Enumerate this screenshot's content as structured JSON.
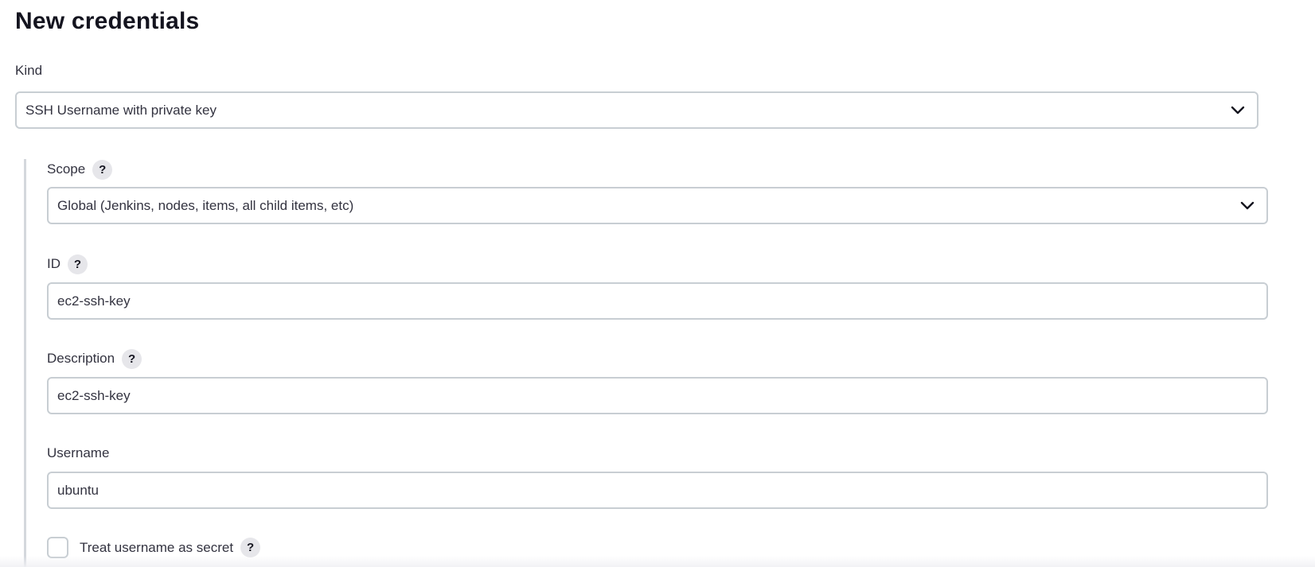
{
  "page": {
    "title": "New credentials"
  },
  "kind": {
    "label": "Kind",
    "selected": "SSH Username with private key"
  },
  "scope": {
    "label": "Scope",
    "help": "?",
    "selected": "Global (Jenkins, nodes, items, all child items, etc)"
  },
  "id_field": {
    "label": "ID",
    "help": "?",
    "value": "ec2-ssh-key"
  },
  "description": {
    "label": "Description",
    "help": "?",
    "value": "ec2-ssh-key"
  },
  "username": {
    "label": "Username",
    "value": "ubuntu"
  },
  "secret_toggle": {
    "label": "Treat username as secret",
    "help": "?",
    "checked": false
  },
  "icons": {
    "dropdown": "chevron-down-icon",
    "help": "question-mark-icon"
  },
  "colors": {
    "border": "#c8ced3",
    "help_bg": "#e6e6ea",
    "text": "#333340",
    "heading": "#14141f"
  }
}
